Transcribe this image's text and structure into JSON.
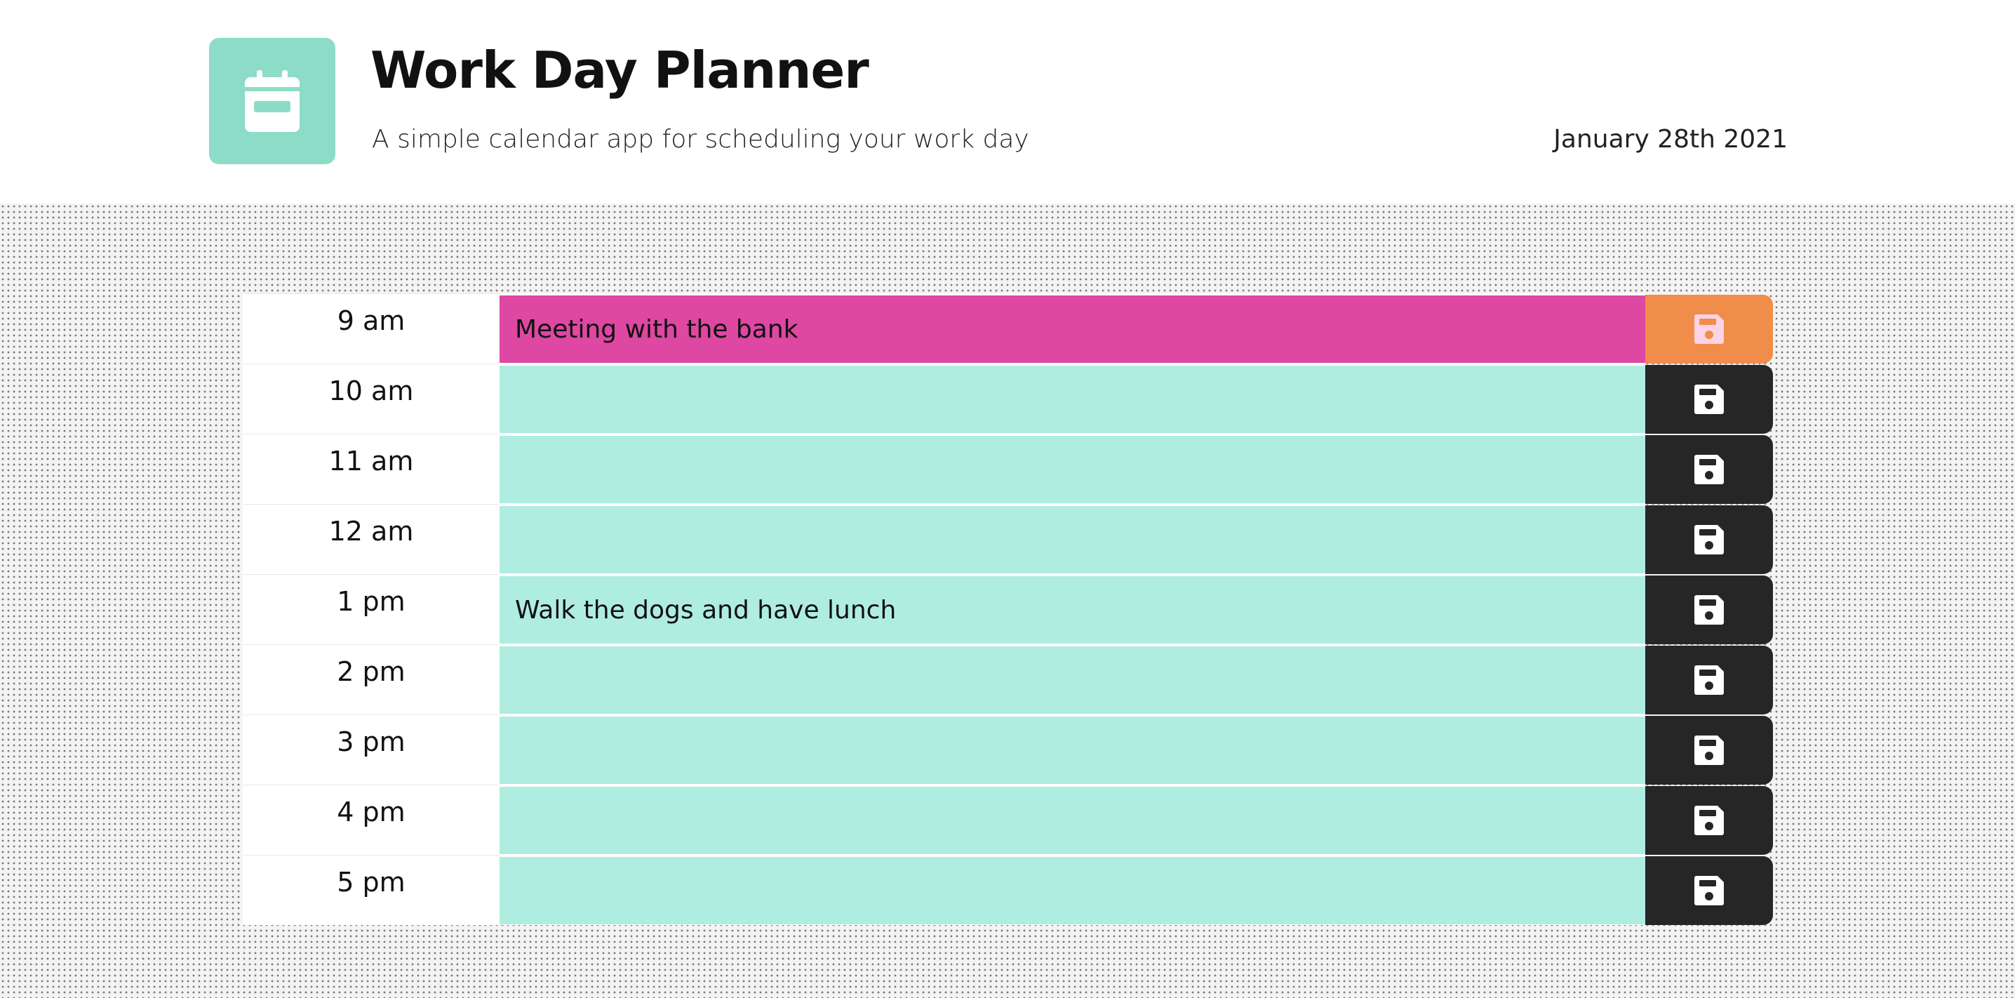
{
  "header": {
    "title": "Work Day Planner",
    "subtitle": "A simple calendar app for scheduling your work day",
    "date": "January 28th 2021",
    "logo_icon": "calendar-icon",
    "logo_color": "#8ddcc8"
  },
  "colors": {
    "present": "#de47a2",
    "future": "#afede0",
    "save_present": "#f08d4a",
    "save_default": "#262626",
    "save_icon_present": "#fbd3e4",
    "save_icon_default": "#ffffff"
  },
  "rows": [
    {
      "hour": "9 am",
      "task": "Meeting with the bank",
      "state": "present"
    },
    {
      "hour": "10 am",
      "task": "",
      "state": "future"
    },
    {
      "hour": "11 am",
      "task": "",
      "state": "future"
    },
    {
      "hour": "12 am",
      "task": "",
      "state": "future"
    },
    {
      "hour": "1 pm",
      "task": "Walk the dogs and have lunch",
      "state": "future"
    },
    {
      "hour": "2 pm",
      "task": "",
      "state": "future"
    },
    {
      "hour": "3 pm",
      "task": "",
      "state": "future"
    },
    {
      "hour": "4 pm",
      "task": "",
      "state": "future"
    },
    {
      "hour": "5 pm",
      "task": "",
      "state": "future"
    }
  ],
  "save_icon": "floppy-disk-icon"
}
